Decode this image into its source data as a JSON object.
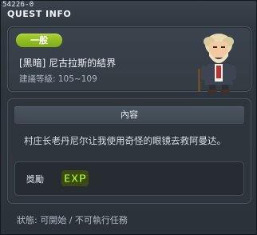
{
  "window": {
    "id_label": "54226-0",
    "title": "QUEST INFO"
  },
  "quest": {
    "category_badge": "一般",
    "name": "[黑暗] 尼古拉斯的結界",
    "level_range": "建議等級: 105~109",
    "npc_icon": "npc-portrait-icon"
  },
  "content": {
    "header": "內容",
    "text": "村庄长老丹尼尔让我使用奇怪的眼镜去救阿曼达。"
  },
  "reward": {
    "label": "獎勵",
    "exp_icon": "exp-icon",
    "exp_text": "EXP"
  },
  "status": {
    "text": "狀態: 可開始 / 不可執行任務"
  },
  "colors": {
    "badge_green": "#8fbd1f",
    "exp_green": "#b6f02a",
    "background": "#2b3239"
  }
}
